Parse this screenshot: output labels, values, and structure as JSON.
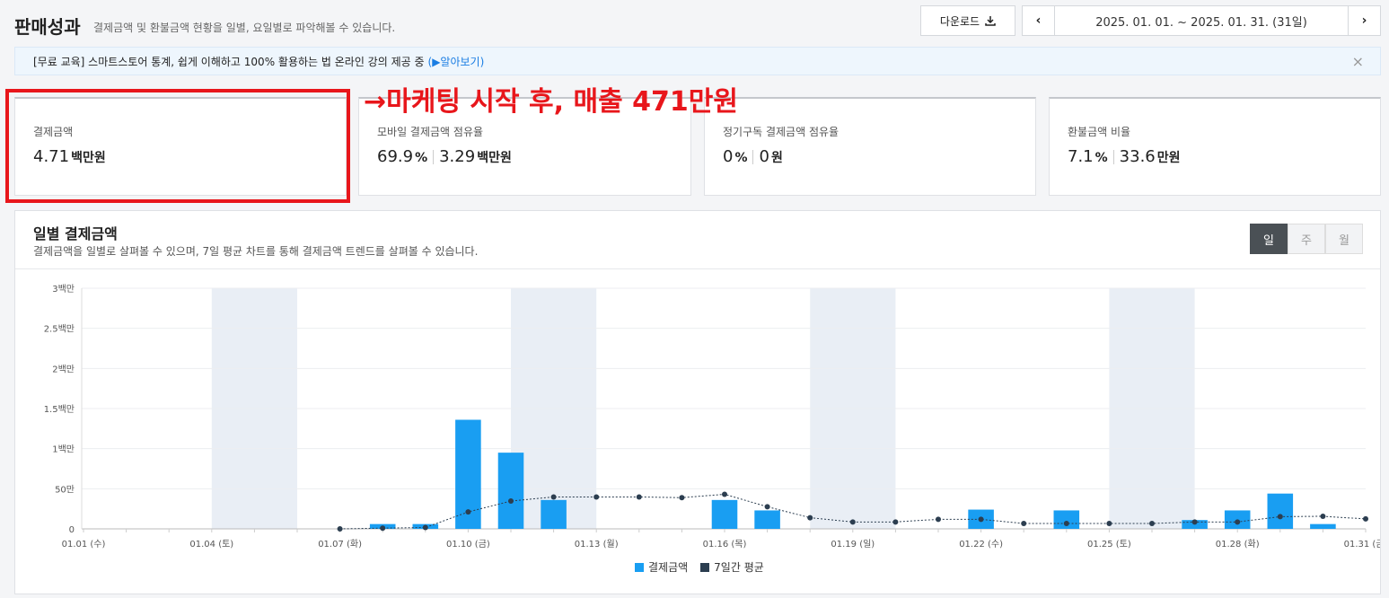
{
  "header": {
    "title": "판매성과",
    "subtitle": "결제금액 및 환불금액 현황을 일별, 요일별로 파악해볼 수 있습니다.",
    "download_label": "다운로드",
    "date_range": "2025. 01. 01. ~ 2025. 01. 31. (31일)"
  },
  "notice": {
    "text": "[무료 교육] 스마트스토어 통계, 쉽게 이해하고 100% 활용하는 법 온라인 강의 제공 중",
    "link": "(▶알아보기)",
    "close": "×"
  },
  "annotation": "→마케팅 시작 후, 매출 471만원",
  "cards": [
    {
      "label": "결제금액",
      "value": "4.71",
      "unit": "백만원"
    },
    {
      "label": "모바일 결제금액 점유율",
      "value": "69.9",
      "unit": "%",
      "value2": "3.29",
      "unit2": "백만원"
    },
    {
      "label": "정기구독 결제금액 점유율",
      "value": "0",
      "unit": "%",
      "value2": "0",
      "unit2": "원"
    },
    {
      "label": "환불금액 비율",
      "value": "7.1",
      "unit": "%",
      "value2": "33.6",
      "unit2": "만원"
    }
  ],
  "chart_panel": {
    "title": "일별 결제금액",
    "description": "결제금액을 일별로 살펴볼 수 있으며, 7일 평균 차트를 통해 결제금액 트렌드를 살펴볼 수 있습니다.",
    "tabs": [
      "일",
      "주",
      "월"
    ],
    "active_tab": "일"
  },
  "colors": {
    "bar": "#199ef2",
    "line": "#2c3e50",
    "weekend": "#e9eef5",
    "accent_red": "#e8161b"
  },
  "chart_data": {
    "type": "bar",
    "categories": [
      "01.01",
      "01.02",
      "01.03",
      "01.04",
      "01.05",
      "01.06",
      "01.07",
      "01.08",
      "01.09",
      "01.10",
      "01.11",
      "01.12",
      "01.13",
      "01.14",
      "01.15",
      "01.16",
      "01.17",
      "01.18",
      "01.19",
      "01.20",
      "01.21",
      "01.22",
      "01.23",
      "01.24",
      "01.25",
      "01.26",
      "01.27",
      "01.28",
      "01.29",
      "01.30",
      "01.31"
    ],
    "x_tick_labels": [
      "01.01 (수)",
      "01.04 (토)",
      "01.07 (화)",
      "01.10 (금)",
      "01.13 (월)",
      "01.16 (목)",
      "01.19 (일)",
      "01.22 (수)",
      "01.25 (토)",
      "01.28 (화)",
      "01.31 (금)"
    ],
    "x_tick_days": [
      1,
      4,
      7,
      10,
      13,
      16,
      19,
      22,
      25,
      28,
      31
    ],
    "y_tick_labels": [
      "0",
      "50만",
      "1백만",
      "1.5백만",
      "2백만",
      "2.5백만",
      "3백만"
    ],
    "y_tick_values": [
      0,
      500000,
      1000000,
      1500000,
      2000000,
      2500000,
      3000000
    ],
    "ylim": [
      0,
      3000000
    ],
    "weekend_bands": [
      [
        4,
        5
      ],
      [
        11,
        12
      ],
      [
        18,
        19
      ],
      [
        25,
        26
      ]
    ],
    "series": [
      {
        "name": "결제금액",
        "type": "bar",
        "values": [
          0,
          0,
          0,
          0,
          0,
          0,
          0,
          60000,
          60000,
          1360000,
          950000,
          360000,
          0,
          0,
          0,
          360000,
          230000,
          0,
          0,
          0,
          0,
          240000,
          0,
          230000,
          0,
          0,
          110000,
          230000,
          440000,
          60000,
          0
        ]
      },
      {
        "name": "7일간 평균",
        "type": "line",
        "start_day": 7,
        "values": [
          0,
          9000,
          17000,
          211000,
          347000,
          398000,
          398000,
          398000,
          389000,
          431000,
          276000,
          139000,
          86000,
          86000,
          119000,
          119000,
          67000,
          67000,
          67000,
          67000,
          86000,
          86000,
          152000,
          157000,
          124000
        ]
      }
    ]
  }
}
